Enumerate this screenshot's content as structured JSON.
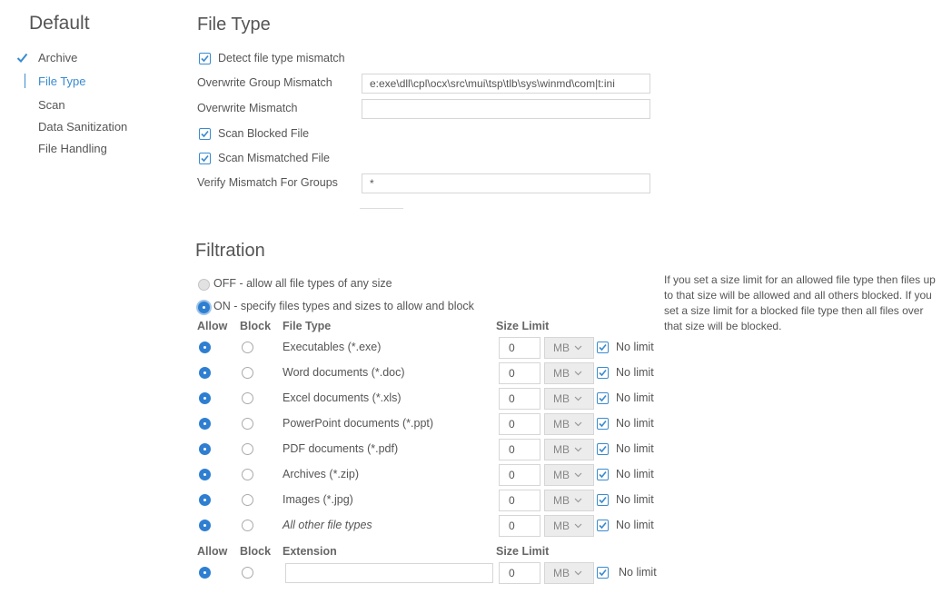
{
  "sidebar": {
    "title": "Default",
    "items": [
      {
        "label": "Archive"
      },
      {
        "label": "File Type"
      },
      {
        "label": "Scan"
      },
      {
        "label": "Data Sanitization"
      },
      {
        "label": "File Handling"
      }
    ]
  },
  "file_type": {
    "title": "File Type",
    "detect_mismatch_label": "Detect file type mismatch",
    "overwrite_group_mismatch_label": "Overwrite Group Mismatch",
    "overwrite_group_mismatch_value": "e:exe\\dll\\cpl\\ocx\\src\\mui\\tsp\\tlb\\sys\\winmd\\com|t:ini",
    "overwrite_mismatch_label": "Overwrite Mismatch",
    "overwrite_mismatch_value": "",
    "scan_blocked_label": "Scan Blocked File",
    "scan_mismatched_label": "Scan Mismatched File",
    "verify_mismatch_label": "Verify Mismatch For Groups",
    "verify_mismatch_value": "*"
  },
  "filtration": {
    "title": "Filtration",
    "off_label": "OFF - allow all file types of any size",
    "on_label": "ON - specify files types and sizes to allow and block",
    "help_text": "If you set a size limit for an allowed file type then files up to that size will be allowed and all others blocked. If you set a size limit for a blocked file type then all files over that size will be blocked.",
    "headers": {
      "allow": "Allow",
      "block": "Block",
      "file_type": "File Type",
      "size_limit": "Size Limit",
      "extension": "Extension"
    },
    "rows": [
      {
        "file_type": "Executables (*.exe)",
        "size": "0",
        "unit": "MB",
        "no_limit": "No limit"
      },
      {
        "file_type": "Word documents (*.doc)",
        "size": "0",
        "unit": "MB",
        "no_limit": "No limit"
      },
      {
        "file_type": "Excel documents (*.xls)",
        "size": "0",
        "unit": "MB",
        "no_limit": "No limit"
      },
      {
        "file_type": "PowerPoint documents (*.ppt)",
        "size": "0",
        "unit": "MB",
        "no_limit": "No limit"
      },
      {
        "file_type": "PDF documents (*.pdf)",
        "size": "0",
        "unit": "MB",
        "no_limit": "No limit"
      },
      {
        "file_type": "Archives (*.zip)",
        "size": "0",
        "unit": "MB",
        "no_limit": "No limit"
      },
      {
        "file_type": "Images (*.jpg)",
        "size": "0",
        "unit": "MB",
        "no_limit": "No limit"
      },
      {
        "file_type": "All other file types",
        "size": "0",
        "unit": "MB",
        "no_limit": "No limit"
      }
    ],
    "extension_row": {
      "extension": "",
      "size": "0",
      "unit": "MB",
      "no_limit": "No limit"
    }
  },
  "colors": {
    "accent": "#3a8bd0",
    "radio_selected": "#2f7fd1"
  }
}
